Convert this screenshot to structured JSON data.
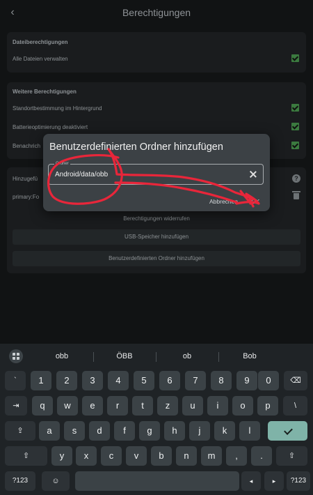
{
  "app": {
    "title": "Berechtigungen",
    "back_icon": "back-arrow-icon"
  },
  "file_permissions": {
    "heading": "Dateiberechtigungen",
    "items": [
      {
        "label": "Alle Dateien verwalten",
        "checked": true
      }
    ]
  },
  "other_permissions": {
    "heading": "Weitere Berechtigungen",
    "items": [
      {
        "label": "Standortbestimmung im Hintergrund",
        "checked": true
      },
      {
        "label": "Batterieoptimierung deaktiviert",
        "checked": true
      },
      {
        "label": "Benachrich",
        "checked": true
      }
    ]
  },
  "added_folders": {
    "heading": "Hinzugefü",
    "item": "primary:Fo",
    "revoke_label": "Berechtigungen widerrufen",
    "usb_button": "USB-Speicher hinzufügen",
    "custom_button": "Benutzerdefinierten Ordner hinzufügen"
  },
  "dialog": {
    "title": "Benutzerdefinierten Ordner hinzufügen",
    "field_label": "Ordner",
    "field_value": "Android/data/obb",
    "cancel_label": "Abbrechen",
    "ok_label": "OK"
  },
  "keyboard": {
    "suggestions": [
      "obb",
      "ÖBB",
      "ob",
      "Bob"
    ],
    "rows": [
      [
        "`",
        "1",
        "2",
        "3",
        "4",
        "5",
        "6",
        "7",
        "8",
        "9",
        "0",
        "⌫"
      ],
      [
        "⇥",
        "q",
        "w",
        "e",
        "r",
        "t",
        "z",
        "u",
        "i",
        "o",
        "p",
        "\\"
      ],
      [
        "⇪",
        "a",
        "s",
        "d",
        "f",
        "g",
        "h",
        "j",
        "k",
        "l",
        "✓"
      ],
      [
        "⇧",
        "y",
        "x",
        "c",
        "v",
        "b",
        "n",
        "m",
        ",",
        ".",
        "⇧"
      ],
      [
        "?123",
        "☺",
        "",
        "◂",
        "▸",
        "?123"
      ]
    ]
  },
  "colors": {
    "accent_check": "#3b7a3f",
    "enter_key": "#7fb3a8",
    "scribble": "#e8263a"
  }
}
